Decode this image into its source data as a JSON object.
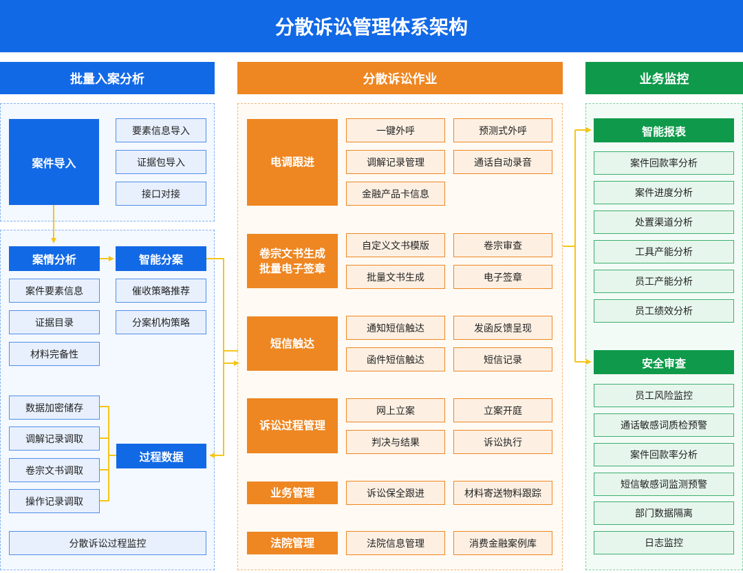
{
  "title": "分散诉讼管理体系架构",
  "columns": {
    "left": "批量入案分析",
    "middle": "分散诉讼作业",
    "right": "业务监控"
  },
  "left": {
    "case_import": "案件导入",
    "import_items": [
      "要素信息导入",
      "证据包导入",
      "接口对接"
    ],
    "case_analysis": "案情分析",
    "analysis_items": [
      "案件要素信息",
      "证据目录",
      "材料完备性"
    ],
    "smart_assign": "智能分案",
    "assign_items": [
      "催收策略推荐",
      "分案机构策略"
    ],
    "data_items": [
      "数据加密储存",
      "调解记录调取",
      "卷宗文书调取",
      "操作记录调取"
    ],
    "process_data": "过程数据",
    "process_monitor": "分散诉讼过程监控"
  },
  "middle": {
    "groups": [
      {
        "name": "电调跟进",
        "items": [
          "一键外呼",
          "预测式外呼",
          "调解记录管理",
          "通话自动录音",
          "金融产品卡信息"
        ]
      },
      {
        "name": "卷宗文书生成\n批量电子签章",
        "items": [
          "自定义文书模版",
          "卷宗审查",
          "批量文书生成",
          "电子签章"
        ]
      },
      {
        "name": "短信触达",
        "items": [
          "通知短信触达",
          "发函反馈呈现",
          "函件短信触达",
          "短信记录"
        ]
      },
      {
        "name": "诉讼过程管理",
        "items": [
          "网上立案",
          "立案开庭",
          "判决与结果",
          "诉讼执行"
        ]
      },
      {
        "name": "业务管理",
        "items": [
          "诉讼保全跟进",
          "材料寄送物料跟踪"
        ]
      },
      {
        "name": "法院管理",
        "items": [
          "法院信息管理",
          "消费金融案例库"
        ]
      }
    ]
  },
  "right": {
    "smart_report": "智能报表",
    "report_items": [
      "案件回款率分析",
      "案件进度分析",
      "处置渠道分析",
      "工具产能分析",
      "员工产能分析",
      "员工绩效分析"
    ],
    "security_audit": "安全审查",
    "audit_items": [
      "员工风险监控",
      "通话敏感词质检预警",
      "案件回款率分析",
      "短信敏感词监测预警",
      "部门数据隔离",
      "日志监控"
    ]
  },
  "colors": {
    "blue": "#1269e6",
    "orange": "#ee8621",
    "green": "#0f9a4b",
    "connector": "#f5c518"
  }
}
